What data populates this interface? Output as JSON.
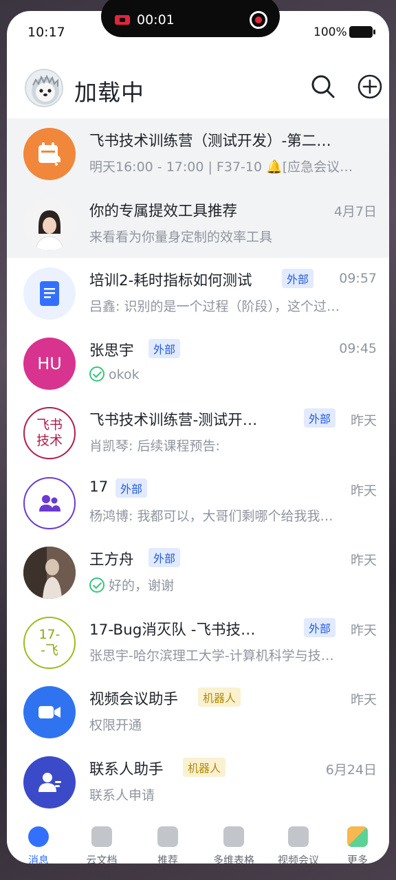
{
  "status_bar": {
    "time": "10:17",
    "battery": "100%"
  },
  "recording": {
    "time": "00:01"
  },
  "header": {
    "title": "加载中"
  },
  "chats": [
    {
      "title": "飞书技术训练营（测试开发）-第二…",
      "subtitle": "明天16:00 - 17:00 | F37-10 🔔[应急会议…",
      "time": "",
      "tag": "",
      "avatar": "calendar-icon"
    },
    {
      "title": "你的专属提效工具推荐",
      "subtitle": "来看看为你量身定制的效率工具",
      "time": "4月7日",
      "tag": "",
      "avatar": "person-photo"
    },
    {
      "title": "培训2-耗时指标如何测试",
      "subtitle": "吕鑫: 识别的是一个过程（阶段），这个过…",
      "time": "09:57",
      "tag": "外部",
      "avatar": "doc-icon"
    },
    {
      "title": "张思宇",
      "subtitle": "okok",
      "time": "09:45",
      "tag": "外部",
      "avatar": "HU"
    },
    {
      "title": "飞书技术训练营-测试开…",
      "subtitle": "肖凯琴: 后续课程预告:",
      "time": "昨天",
      "tag": "外部",
      "avatar": "飞书\n技术"
    },
    {
      "title": "17",
      "subtitle": "杨鸿博: 我都可以，大哥们剩哪个给我我…",
      "time": "昨天",
      "tag": "外部",
      "avatar": "group-icon"
    },
    {
      "title": "王方舟",
      "subtitle": "好的，谢谢",
      "time": "昨天",
      "tag": "外部",
      "avatar": "person-photo"
    },
    {
      "title": "17-Bug消灭队 -飞书技…",
      "subtitle": "张思宇-哈尔滨理工大学-计算机科学与技…",
      "time": "昨天",
      "tag": "外部",
      "avatar": "17-\n-飞"
    },
    {
      "title": "视频会议助手",
      "subtitle": "权限开通",
      "time": "昨天",
      "tag": "机器人",
      "avatar": "video-icon"
    },
    {
      "title": "联系人助手",
      "subtitle": "联系人申请",
      "time": "6月24日",
      "tag": "机器人",
      "avatar": "contact-icon"
    }
  ],
  "tabs": [
    {
      "label": "消息"
    },
    {
      "label": "云文档"
    },
    {
      "label": "推荐"
    },
    {
      "label": "多维表格"
    },
    {
      "label": "视频会议"
    },
    {
      "label": "更多"
    }
  ],
  "colors": {
    "accent": "#3370ff",
    "external_tag": "#245bdb",
    "bot_tag": "#b38a08"
  }
}
